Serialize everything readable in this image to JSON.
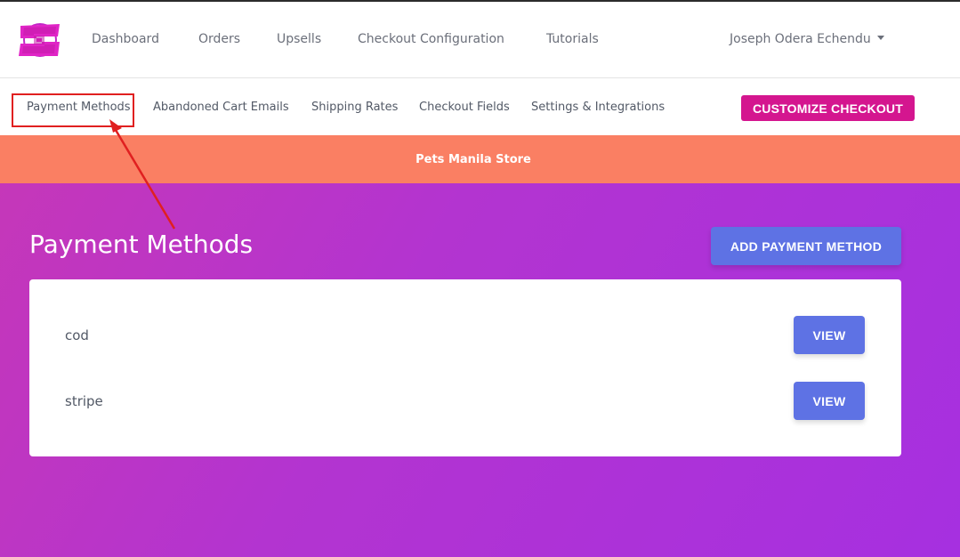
{
  "topnav": {
    "links": [
      "Dashboard",
      "Orders",
      "Upsells",
      "Checkout Configuration",
      "Tutorials"
    ],
    "user_name": "Joseph Odera Echendu"
  },
  "subnav": {
    "links": [
      "Payment Methods",
      "Abandoned Cart Emails",
      "Shipping Rates",
      "Checkout Fields",
      "Settings & Integrations"
    ],
    "customize_label": "CUSTOMIZE CHECKOUT"
  },
  "store": {
    "name": "Pets Manila Store"
  },
  "main": {
    "title": "Payment Methods",
    "add_label": "ADD PAYMENT METHOD",
    "methods": [
      {
        "name": "cod",
        "action": "VIEW"
      },
      {
        "name": "stripe",
        "action": "VIEW"
      }
    ]
  },
  "colors": {
    "brand_pink": "#d4168f",
    "banner_orange": "#fa7f63",
    "button_blue": "#5e72e4",
    "gradient_start": "#c537b9",
    "gradient_end": "#a630e0",
    "annotation_red": "#e02020"
  }
}
